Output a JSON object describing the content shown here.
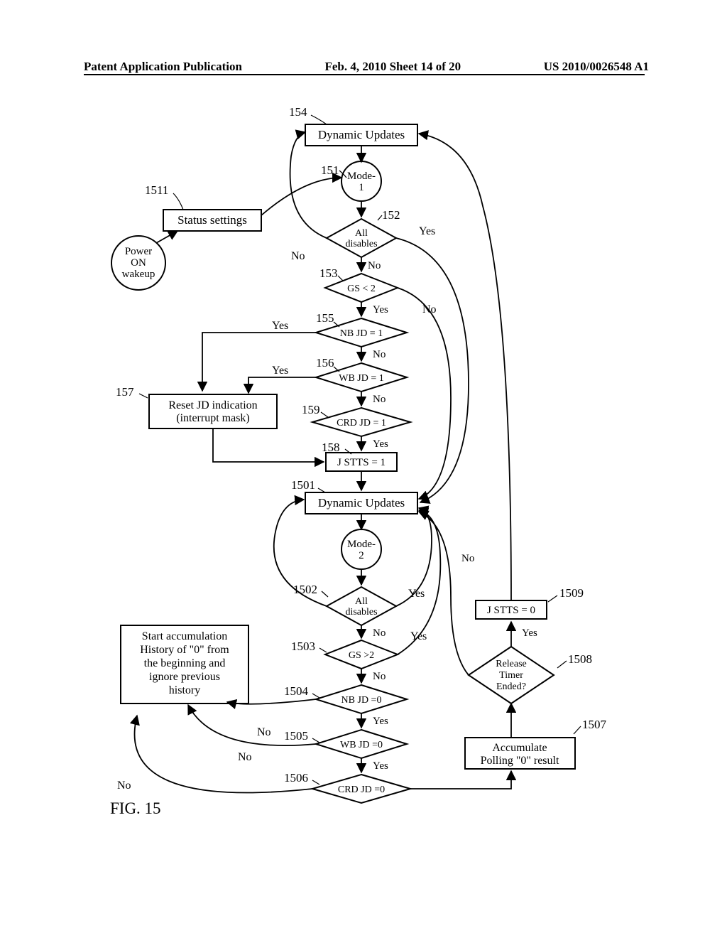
{
  "header": {
    "left": "Patent Application Publication",
    "center": "Feb. 4, 2010  Sheet 14 of 20",
    "right": "US 2010/0026548 A1"
  },
  "figLabel": "FIG. 15",
  "refs": {
    "r154": "154",
    "r151": "151",
    "r1511": "1511",
    "r152": "152",
    "r153": "153",
    "r155": "155",
    "r156": "156",
    "r157": "157",
    "r159": "159",
    "r158": "158",
    "r1501": "1501",
    "r1502": "1502",
    "r1503": "1503",
    "r1504": "1504",
    "r1505": "1505",
    "r1506": "1506",
    "r1507": "1507",
    "r1508": "1508",
    "r1509": "1509"
  },
  "nodes": {
    "dynUp1": "Dynamic Updates",
    "mode1": "Mode-\n1",
    "mode1_l1": "Mode-",
    "mode1_l2": "1",
    "statusSettings": "Status settings",
    "powerOn": "Power\nON\nwakeup",
    "powerOn_l1": "Power",
    "powerOn_l2": "ON",
    "powerOn_l3": "wakeup",
    "allDisables1": "All\ndisables",
    "allDisables1_l1": "All",
    "allDisables1_l2": "disables",
    "gsLt2": "GS < 2",
    "nbjd1": "NB JD = 1",
    "wbjd1": "WB JD = 1",
    "crdjd1": "CRD JD = 1",
    "resetJD": "Reset JD indication\n(interrupt mask)",
    "resetJD_l1": "Reset JD indication",
    "resetJD_l2": "(interrupt mask)",
    "jstts1": "J STTS = 1",
    "dynUp2": "Dynamic Updates",
    "mode2_l1": "Mode-",
    "mode2_l2": "2",
    "allDisables2_l1": "All",
    "allDisables2_l2": "disables",
    "gsGt2": "GS >2",
    "nbjd0": "NB JD =0",
    "wbjd0": "WB JD =0",
    "crdjd0": "CRD JD =0",
    "startAccum_l1": "Start accumulation",
    "startAccum_l2": "History of \"0\" from",
    "startAccum_l3": "the beginning and",
    "startAccum_l4": "ignore previous",
    "startAccum_l5": "history",
    "releaseTimer_l1": "Release",
    "releaseTimer_l2": "Timer",
    "releaseTimer_l3": "Ended?",
    "accumPoll_l1": "Accumulate",
    "accumPoll_l2": "Polling \"0\" result",
    "jstts0": "J STTS = 0"
  },
  "edges": {
    "yes": "Yes",
    "no": "No"
  }
}
